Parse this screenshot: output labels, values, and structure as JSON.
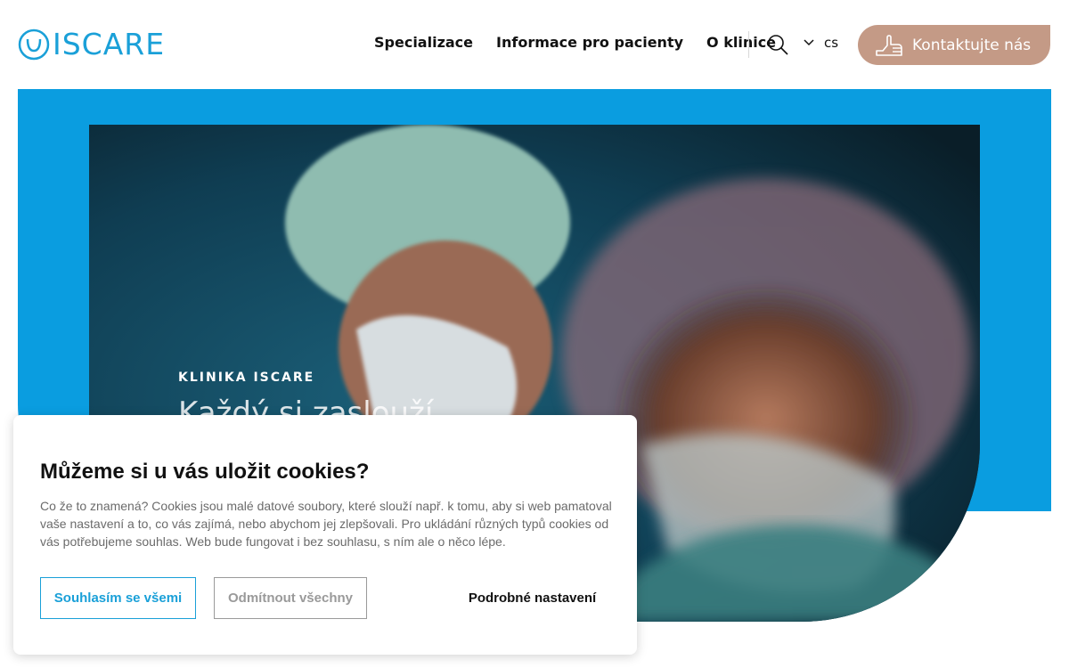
{
  "header": {
    "logo_text": "ISCARE",
    "nav": [
      "Specializace",
      "Informace pro pacienty",
      "O klinice"
    ],
    "language": "cs",
    "contact_label": "Kontaktujte nás",
    "icons": {
      "search": "search-icon",
      "language_toggle": "chevron-down-icon",
      "contact": "hand-icon"
    }
  },
  "hero": {
    "eyebrow": "KLINIKA ISCARE",
    "title": "Každý si zaslouží"
  },
  "cookie_dialog": {
    "title": "Můžeme si u vás uložit cookies?",
    "text": "Co že to znamená? Cookies jsou malé datové soubory, které slouží např. k tomu, aby si web pamatoval vaše nastavení a to, co vás zajímá, nebo abychom jej zlepšovali. Pro ukládání různých typů cookies od vás potřebujeme souhlas. Web bude fungovat i bez souhlasu, s ním ale o něco lépe.",
    "accept_label": "Souhlasím se všemi",
    "reject_label": "Odmítnout všechny",
    "settings_label": "Podrobné nastavení"
  },
  "colors": {
    "brand_blue": "#0a9de0",
    "logo_blue": "#1aa0d8",
    "contact_button": "#c49a86"
  }
}
